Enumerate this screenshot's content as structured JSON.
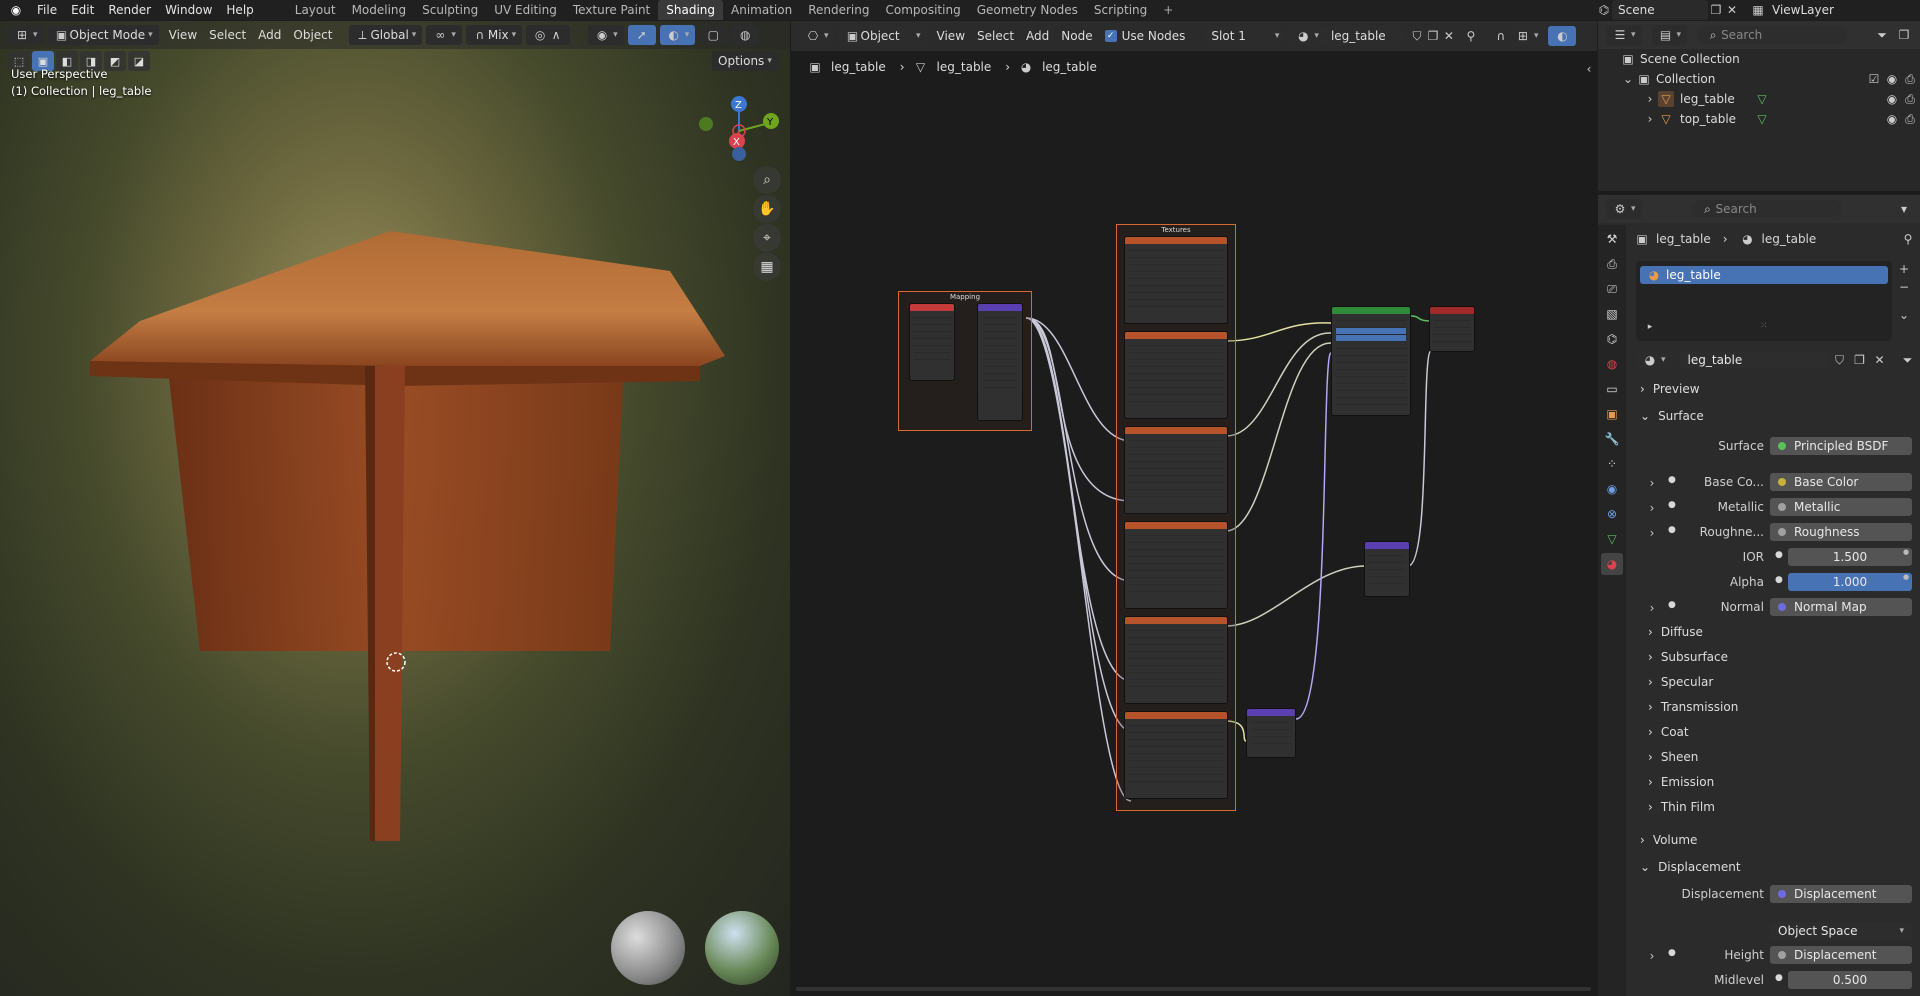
{
  "topbar": {
    "menus": [
      "File",
      "Edit",
      "Render",
      "Window",
      "Help"
    ],
    "workspaces": [
      "Layout",
      "Modeling",
      "Sculpting",
      "UV Editing",
      "Texture Paint",
      "Shading",
      "Animation",
      "Rendering",
      "Compositing",
      "Geometry Nodes",
      "Scripting"
    ],
    "active_workspace": "Shading",
    "add_tab": "+",
    "scene": "Scene",
    "view_layer": "ViewLayer"
  },
  "viewport": {
    "mode": "Object Mode",
    "menus": [
      "View",
      "Select",
      "Add",
      "Object"
    ],
    "orientation": "Global",
    "snap_mode": "Mix",
    "options_label": "Options",
    "overlay_line1": "User Perspective",
    "overlay_line2": "(1) Collection | leg_table",
    "gizmo": {
      "z": "Z",
      "y": "Y",
      "x": "X"
    }
  },
  "node_editor": {
    "type": "Object",
    "menus": [
      "View",
      "Select",
      "Add",
      "Node"
    ],
    "use_nodes_label": "Use Nodes",
    "use_nodes": true,
    "slot": "Slot 1",
    "material": "leg_table",
    "breadcrumb": [
      "leg_table",
      "leg_table",
      "leg_table"
    ],
    "frames": {
      "mapping": "Mapping",
      "textures": "Textures"
    }
  },
  "outliner": {
    "search_placeholder": "Search",
    "root": "Scene Collection",
    "collection": "Collection",
    "objects": [
      "leg_table",
      "top_table"
    ]
  },
  "properties": {
    "search_placeholder": "Search",
    "breadcrumb": [
      "leg_table",
      "leg_table"
    ],
    "material_slot": "leg_table",
    "material_name": "leg_table",
    "sections": {
      "preview": "Preview",
      "surface": "Surface",
      "volume": "Volume",
      "displacement": "Displacement"
    },
    "surface_label": "Surface",
    "surface_value": "Principled BSDF",
    "inputs": [
      {
        "label": "Base Co...",
        "value": "Base Color",
        "dot": "#c7b23a"
      },
      {
        "label": "Metallic",
        "value": "Metallic",
        "dot": "#a0a0a0"
      },
      {
        "label": "Roughne...",
        "value": "Roughness",
        "dot": "#a0a0a0"
      }
    ],
    "ior_label": "IOR",
    "ior_value": "1.500",
    "alpha_label": "Alpha",
    "alpha_value": "1.000",
    "normal_label": "Normal",
    "normal_value": "Normal Map",
    "subpanels": [
      "Diffuse",
      "Subsurface",
      "Specular",
      "Transmission",
      "Coat",
      "Sheen",
      "Emission",
      "Thin Film"
    ],
    "displacement_label": "Displacement",
    "displacement_value": "Displacement",
    "space_value": "Object Space",
    "height_label": "Height",
    "height_value": "Displacement",
    "midlevel_label": "Midlevel",
    "midlevel_value": "0.500"
  }
}
